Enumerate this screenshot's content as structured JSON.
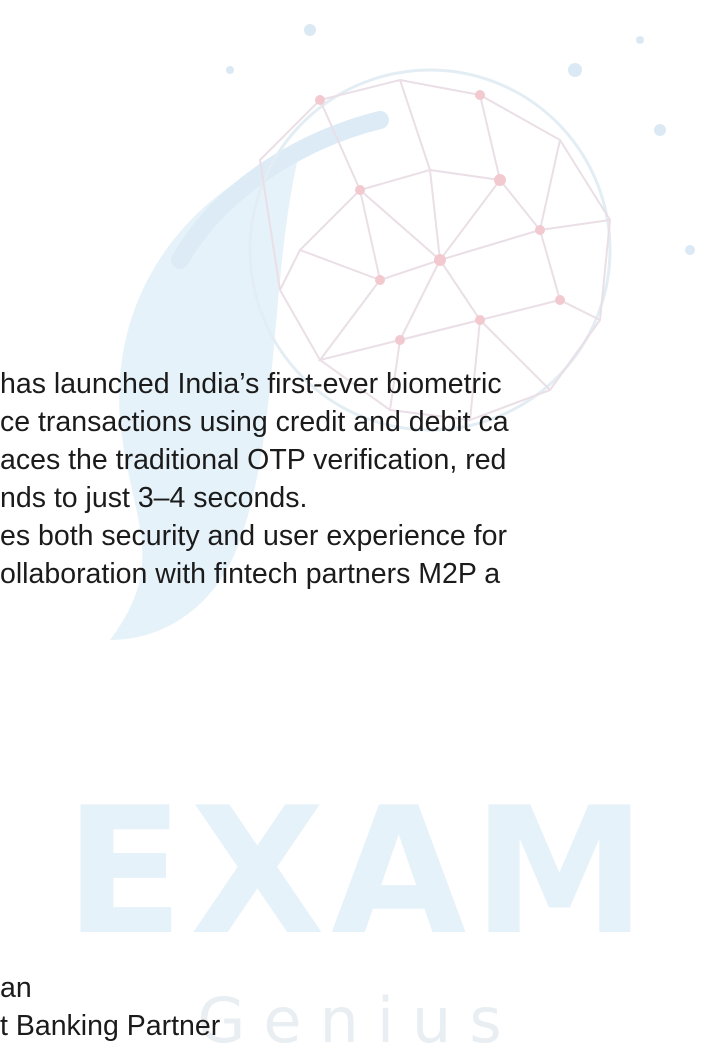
{
  "watermark": {
    "word": "EXAM",
    "sub": "Genius"
  },
  "article": {
    "lines": [
      " has launched India’s first-ever biometric",
      "ce transactions using credit and debit ca",
      "aces the traditional OTP verification, red",
      "nds to just 3–4 seconds.",
      "es both security and user experience for",
      "ollaboration with fintech partners M2P a"
    ],
    "footer_lines": [
      "an",
      "t Banking Partner"
    ]
  },
  "colors": {
    "text": "#1b1b1b",
    "watermark_blue": "#e6f2fa",
    "watermark_red": "#f7dde0"
  }
}
